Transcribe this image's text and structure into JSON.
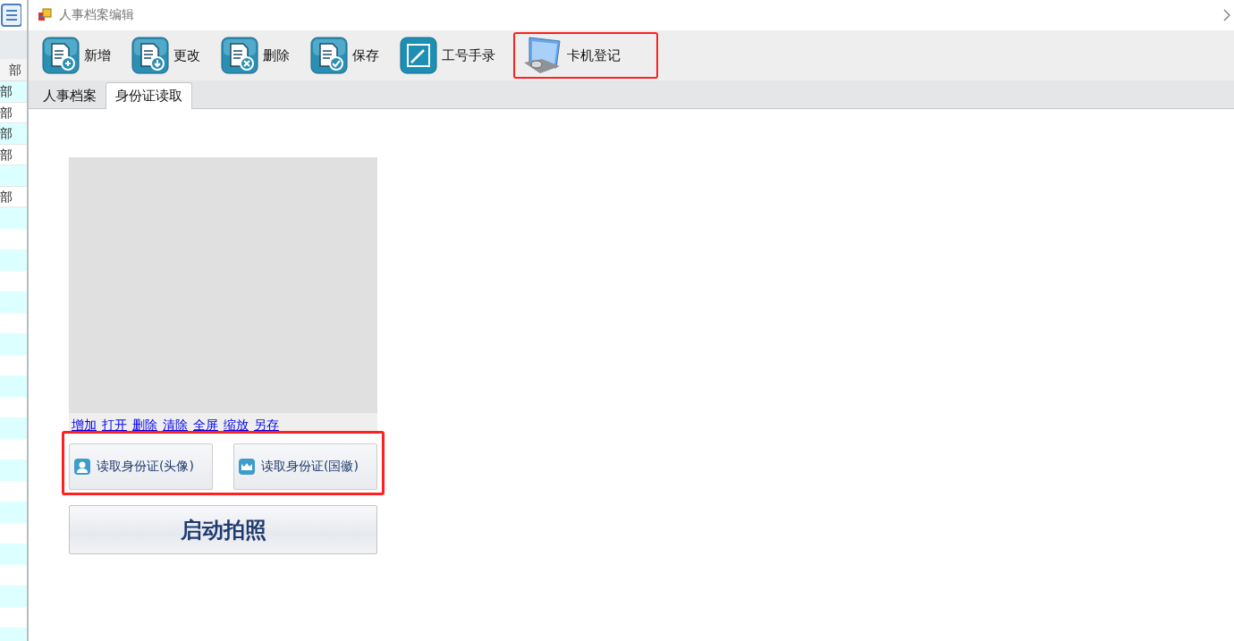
{
  "background_window": {
    "header": "部",
    "rows": [
      {
        "cell": "部"
      },
      {
        "cell": "部"
      },
      {
        "cell": "部"
      },
      {
        "cell": "部"
      },
      {},
      {
        "cell": "部"
      }
    ]
  },
  "window": {
    "title": "人事档案编辑"
  },
  "toolbar": [
    {
      "label": "新增",
      "kind": "doc-add",
      "highlighted": false
    },
    {
      "label": "更改",
      "kind": "doc-down",
      "highlighted": false
    },
    {
      "label": "删除",
      "kind": "doc-remove",
      "highlighted": false
    },
    {
      "label": "保存",
      "kind": "doc-check",
      "highlighted": false
    },
    {
      "label": "工号手录",
      "kind": "sign",
      "highlighted": false
    },
    {
      "label": "卡机登记",
      "kind": "card-machine",
      "highlighted": true
    }
  ],
  "tabs": [
    {
      "label": "人事档案",
      "selected": false
    },
    {
      "label": "身份证读取",
      "selected": true
    }
  ],
  "photo_links": [
    "增加",
    "打开",
    "删除",
    "清除",
    "全屏",
    "缩放",
    "另存"
  ],
  "id_buttons": {
    "highlighted": true,
    "items": [
      {
        "label": "读取身份证(头像)",
        "kind": "portrait"
      },
      {
        "label": "读取身份证(国徽)",
        "kind": "emblem"
      }
    ]
  },
  "camera_button": "启动拍照"
}
